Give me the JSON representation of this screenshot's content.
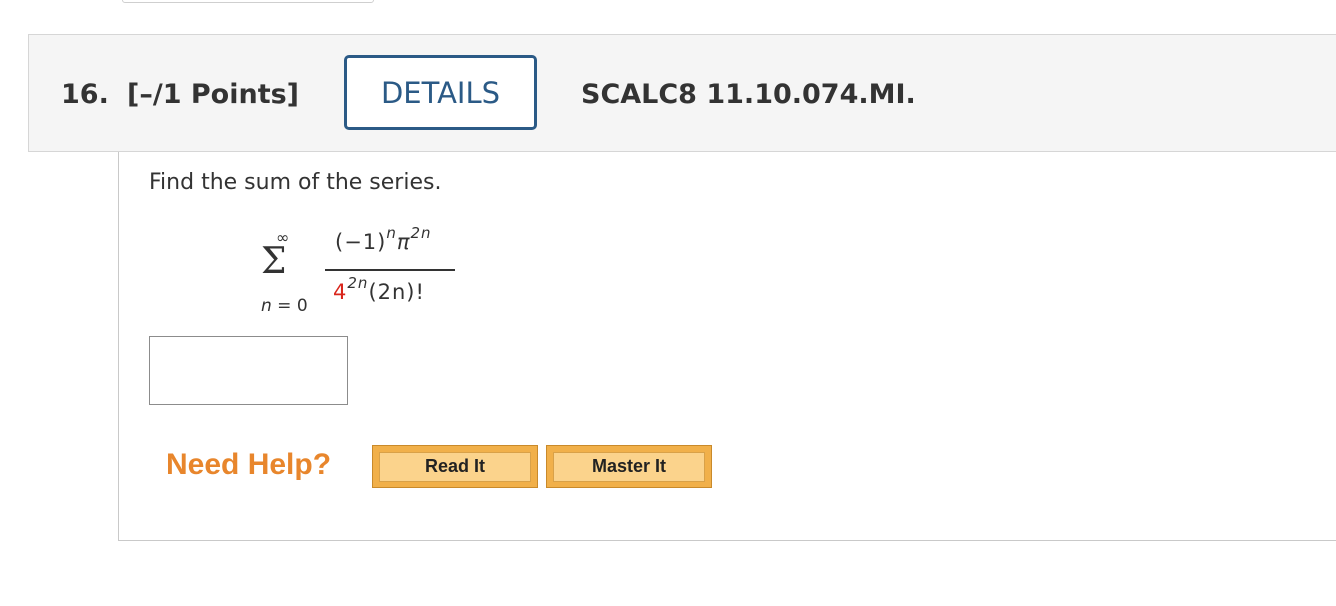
{
  "question": {
    "number": "16.",
    "points": "[–/1 Points]",
    "details_label": "DETAILS",
    "code": "SCALC8 11.10.074.MI."
  },
  "content": {
    "prompt": "Find the sum of the series.",
    "series": {
      "sigma": "Σ",
      "upper_limit": "∞",
      "lower_limit_var": "n",
      "lower_limit_eq": " = 0",
      "numerator_base": "(−1)",
      "numerator_exp1": "n",
      "numerator_pi": "π",
      "numerator_exp2": "2n",
      "denominator_base": "4",
      "denominator_exp": "2n",
      "denominator_rest": "(2n)!"
    },
    "answer_value": ""
  },
  "help": {
    "label": "Need Help?",
    "read_it": "Read It",
    "master_it": "Master It"
  },
  "colors": {
    "details_border": "#2b5a86",
    "need_help": "#e8862c",
    "button_fill": "#f1b04a",
    "highlight": "#d9261c"
  }
}
